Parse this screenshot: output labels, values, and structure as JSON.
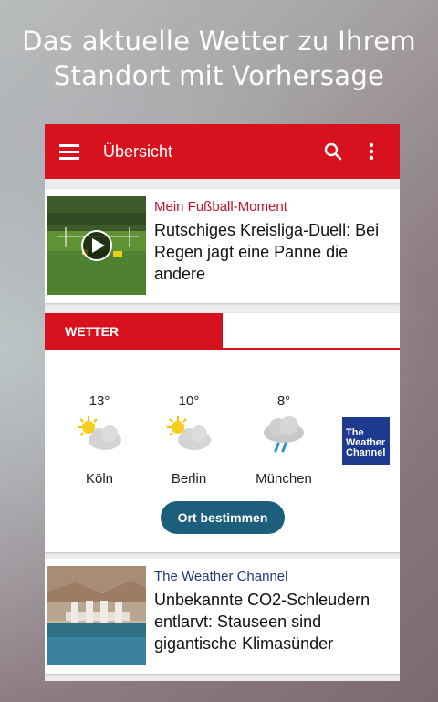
{
  "promo": {
    "headline_line1": "Das aktuelle Wetter zu Ihrem",
    "headline_line2": "Standort mit Vorhersage"
  },
  "appbar": {
    "title": "Übersicht",
    "color": "#d8111e"
  },
  "news": [
    {
      "category": "Mein Fußball-Moment",
      "category_color": "#c8102e",
      "title": "Rutschiges Kreisliga-Duell: Bei Regen jagt eine Panne die andere",
      "thumbnail": "soccer-video-thumbnail"
    },
    {
      "category": "The Weather Channel",
      "category_color": "#1d3a7a",
      "title": "Unbekannte CO2-Schleudern entlarvt: Stauseen sind gigantische Klimasünder",
      "thumbnail": "dam-reservoir-photo"
    }
  ],
  "weather": {
    "tab_label": "WETTER",
    "cities": [
      {
        "name": "Köln",
        "temp": "13°",
        "icon": "partly-cloudy-icon"
      },
      {
        "name": "Berlin",
        "temp": "10°",
        "icon": "partly-cloudy-icon"
      },
      {
        "name": "München",
        "temp": "8°",
        "icon": "rain-cloud-icon"
      }
    ],
    "provider_logo": {
      "line1": "The",
      "line2": "Weather",
      "line3": "Channel"
    },
    "locate_button": "Ort bestimmen",
    "button_color": "#1d5e7c"
  }
}
